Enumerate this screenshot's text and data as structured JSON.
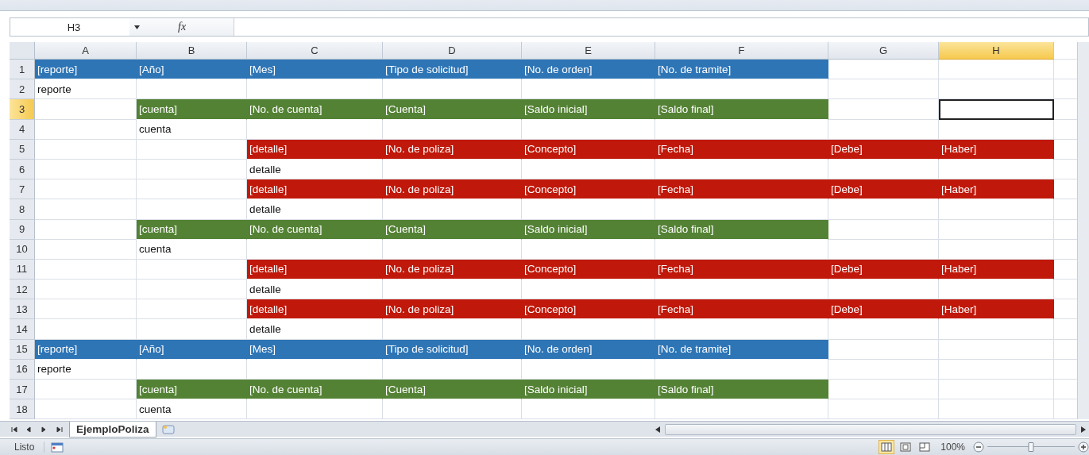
{
  "formula_bar": {
    "name_box": "H3",
    "fx_label": "fx"
  },
  "columns": [
    {
      "label": "A",
      "selected": false
    },
    {
      "label": "B",
      "selected": false
    },
    {
      "label": "C",
      "selected": false
    },
    {
      "label": "D",
      "selected": false
    },
    {
      "label": "E",
      "selected": false
    },
    {
      "label": "F",
      "selected": false
    },
    {
      "label": "G",
      "selected": false
    },
    {
      "label": "H",
      "selected": true
    }
  ],
  "rows": [
    {
      "number": "1",
      "selected": false,
      "cells": [
        {
          "text": "[reporte]",
          "color": "#2e75b6",
          "selected": false
        },
        {
          "text": "[Año]",
          "color": "#2e75b6",
          "selected": false
        },
        {
          "text": "[Mes]",
          "color": "#2e75b6",
          "selected": false
        },
        {
          "text": "[Tipo de solicitud]",
          "color": "#2e75b6",
          "selected": false
        },
        {
          "text": "[No. de orden]",
          "color": "#2e75b6",
          "selected": false
        },
        {
          "text": "[No. de tramite]",
          "color": "#2e75b6",
          "selected": false
        },
        {
          "selected": false
        },
        {
          "selected": false
        }
      ]
    },
    {
      "number": "2",
      "selected": false,
      "cells": [
        {
          "text": "reporte",
          "selected": false
        },
        {
          "selected": false
        },
        {
          "selected": false
        },
        {
          "selected": false
        },
        {
          "selected": false
        },
        {
          "selected": false
        },
        {
          "selected": false
        },
        {
          "selected": false
        }
      ]
    },
    {
      "number": "3",
      "selected": true,
      "cells": [
        {
          "selected": false
        },
        {
          "text": "[cuenta]",
          "color": "#548235",
          "selected": false
        },
        {
          "text": "[No. de cuenta]",
          "color": "#548235",
          "selected": false
        },
        {
          "text": "[Cuenta]",
          "color": "#548235",
          "selected": false
        },
        {
          "text": "[Saldo inicial]",
          "color": "#548235",
          "selected": false
        },
        {
          "text": "[Saldo final]",
          "color": "#548235",
          "selected": false
        },
        {
          "selected": false
        },
        {
          "selected": true
        }
      ]
    },
    {
      "number": "4",
      "selected": false,
      "cells": [
        {
          "selected": false
        },
        {
          "text": "cuenta",
          "selected": false
        },
        {
          "selected": false
        },
        {
          "selected": false
        },
        {
          "selected": false
        },
        {
          "selected": false
        },
        {
          "selected": false
        },
        {
          "selected": false
        }
      ]
    },
    {
      "number": "5",
      "selected": false,
      "cells": [
        {
          "selected": false
        },
        {
          "selected": false
        },
        {
          "text": "[detalle]",
          "color": "#c0180a",
          "selected": false
        },
        {
          "text": "[No. de poliza]",
          "color": "#c0180a",
          "selected": false
        },
        {
          "text": "[Concepto]",
          "color": "#c0180a",
          "selected": false
        },
        {
          "text": "[Fecha]",
          "color": "#c0180a",
          "selected": false
        },
        {
          "text": "[Debe]",
          "color": "#c0180a",
          "selected": false
        },
        {
          "text": "[Haber]",
          "color": "#c0180a",
          "selected": false
        }
      ]
    },
    {
      "number": "6",
      "selected": false,
      "cells": [
        {
          "selected": false
        },
        {
          "selected": false
        },
        {
          "text": "detalle",
          "selected": false
        },
        {
          "selected": false
        },
        {
          "selected": false
        },
        {
          "selected": false
        },
        {
          "selected": false
        },
        {
          "selected": false
        }
      ]
    },
    {
      "number": "7",
      "selected": false,
      "cells": [
        {
          "selected": false
        },
        {
          "selected": false
        },
        {
          "text": "[detalle]",
          "color": "#c0180a",
          "selected": false
        },
        {
          "text": "[No. de poliza]",
          "color": "#c0180a",
          "selected": false
        },
        {
          "text": "[Concepto]",
          "color": "#c0180a",
          "selected": false
        },
        {
          "text": "[Fecha]",
          "color": "#c0180a",
          "selected": false
        },
        {
          "text": "[Debe]",
          "color": "#c0180a",
          "selected": false
        },
        {
          "text": "[Haber]",
          "color": "#c0180a",
          "selected": false
        }
      ]
    },
    {
      "number": "8",
      "selected": false,
      "cells": [
        {
          "selected": false
        },
        {
          "selected": false
        },
        {
          "text": "detalle",
          "selected": false
        },
        {
          "selected": false
        },
        {
          "selected": false
        },
        {
          "selected": false
        },
        {
          "selected": false
        },
        {
          "selected": false
        }
      ]
    },
    {
      "number": "9",
      "selected": false,
      "cells": [
        {
          "selected": false
        },
        {
          "text": "[cuenta]",
          "color": "#548235",
          "selected": false
        },
        {
          "text": "[No. de cuenta]",
          "color": "#548235",
          "selected": false
        },
        {
          "text": "[Cuenta]",
          "color": "#548235",
          "selected": false
        },
        {
          "text": "[Saldo inicial]",
          "color": "#548235",
          "selected": false
        },
        {
          "text": "[Saldo final]",
          "color": "#548235",
          "selected": false
        },
        {
          "selected": false
        },
        {
          "selected": false
        }
      ]
    },
    {
      "number": "10",
      "selected": false,
      "cells": [
        {
          "selected": false
        },
        {
          "text": "cuenta",
          "selected": false
        },
        {
          "selected": false
        },
        {
          "selected": false
        },
        {
          "selected": false
        },
        {
          "selected": false
        },
        {
          "selected": false
        },
        {
          "selected": false
        }
      ]
    },
    {
      "number": "11",
      "selected": false,
      "cells": [
        {
          "selected": false
        },
        {
          "selected": false
        },
        {
          "text": "[detalle]",
          "color": "#c0180a",
          "selected": false
        },
        {
          "text": "[No. de poliza]",
          "color": "#c0180a",
          "selected": false
        },
        {
          "text": "[Concepto]",
          "color": "#c0180a",
          "selected": false
        },
        {
          "text": "[Fecha]",
          "color": "#c0180a",
          "selected": false
        },
        {
          "text": "[Debe]",
          "color": "#c0180a",
          "selected": false
        },
        {
          "text": "[Haber]",
          "color": "#c0180a",
          "selected": false
        }
      ]
    },
    {
      "number": "12",
      "selected": false,
      "cells": [
        {
          "selected": false
        },
        {
          "selected": false
        },
        {
          "text": "detalle",
          "selected": false
        },
        {
          "selected": false
        },
        {
          "selected": false
        },
        {
          "selected": false
        },
        {
          "selected": false
        },
        {
          "selected": false
        }
      ]
    },
    {
      "number": "13",
      "selected": false,
      "cells": [
        {
          "selected": false
        },
        {
          "selected": false
        },
        {
          "text": "[detalle]",
          "color": "#c0180a",
          "selected": false
        },
        {
          "text": "[No. de poliza]",
          "color": "#c0180a",
          "selected": false
        },
        {
          "text": "[Concepto]",
          "color": "#c0180a",
          "selected": false
        },
        {
          "text": "[Fecha]",
          "color": "#c0180a",
          "selected": false
        },
        {
          "text": "[Debe]",
          "color": "#c0180a",
          "selected": false
        },
        {
          "text": "[Haber]",
          "color": "#c0180a",
          "selected": false
        }
      ]
    },
    {
      "number": "14",
      "selected": false,
      "cells": [
        {
          "selected": false
        },
        {
          "selected": false
        },
        {
          "text": "detalle",
          "selected": false
        },
        {
          "selected": false
        },
        {
          "selected": false
        },
        {
          "selected": false
        },
        {
          "selected": false
        },
        {
          "selected": false
        }
      ]
    },
    {
      "number": "15",
      "selected": false,
      "cells": [
        {
          "text": "[reporte]",
          "color": "#2e75b6",
          "selected": false
        },
        {
          "text": "[Año]",
          "color": "#2e75b6",
          "selected": false
        },
        {
          "text": "[Mes]",
          "color": "#2e75b6",
          "selected": false
        },
        {
          "text": "[Tipo de solicitud]",
          "color": "#2e75b6",
          "selected": false
        },
        {
          "text": "[No. de orden]",
          "color": "#2e75b6",
          "selected": false
        },
        {
          "text": "[No. de tramite]",
          "color": "#2e75b6",
          "selected": false
        },
        {
          "selected": false
        },
        {
          "selected": false
        }
      ]
    },
    {
      "number": "16",
      "selected": false,
      "cells": [
        {
          "text": "reporte",
          "selected": false
        },
        {
          "selected": false
        },
        {
          "selected": false
        },
        {
          "selected": false
        },
        {
          "selected": false
        },
        {
          "selected": false
        },
        {
          "selected": false
        },
        {
          "selected": false
        }
      ]
    },
    {
      "number": "17",
      "selected": false,
      "cells": [
        {
          "selected": false
        },
        {
          "text": "[cuenta]",
          "color": "#548235",
          "selected": false
        },
        {
          "text": "[No. de cuenta]",
          "color": "#548235",
          "selected": false
        },
        {
          "text": "[Cuenta]",
          "color": "#548235",
          "selected": false
        },
        {
          "text": "[Saldo inicial]",
          "color": "#548235",
          "selected": false
        },
        {
          "text": "[Saldo final]",
          "color": "#548235",
          "selected": false
        },
        {
          "selected": false
        },
        {
          "selected": false
        }
      ]
    },
    {
      "number": "18",
      "selected": false,
      "cells": [
        {
          "selected": false
        },
        {
          "text": "cuenta",
          "selected": false
        },
        {
          "selected": false
        },
        {
          "selected": false
        },
        {
          "selected": false
        },
        {
          "selected": false
        },
        {
          "selected": false
        },
        {
          "selected": false
        }
      ]
    }
  ],
  "sheet_tabs": [
    {
      "label": "EjemploPoliza",
      "selected": true
    }
  ],
  "status_bar": {
    "status": "Listo",
    "views": [
      {
        "selected": true
      },
      {
        "selected": false
      },
      {
        "selected": false
      }
    ],
    "zoom": "100%",
    "zoom_slider": {
      "level": 0.5
    }
  }
}
